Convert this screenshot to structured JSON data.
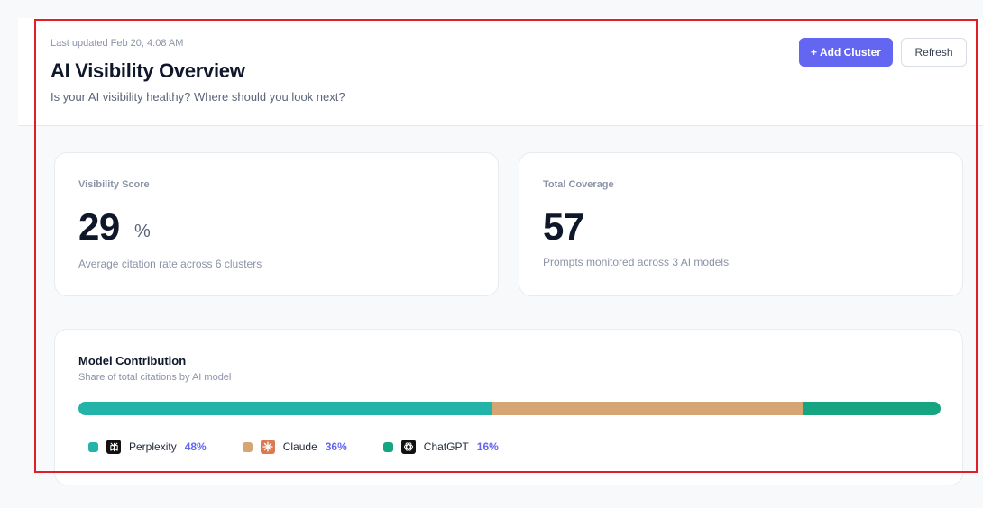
{
  "header": {
    "last_updated": "Last updated Feb 20, 4:08 AM",
    "title": "AI Visibility Overview",
    "subtitle": "Is your AI visibility healthy? Where should you look next?",
    "add_cluster_label": "+ Add Cluster",
    "refresh_label": "Refresh"
  },
  "stats": {
    "visibility": {
      "label": "Visibility Score",
      "value": "29",
      "unit": "%",
      "description": "Average citation rate across 6 clusters"
    },
    "coverage": {
      "label": "Total Coverage",
      "value": "57",
      "description": "Prompts monitored across 3 AI models"
    }
  },
  "models": {
    "title": "Model Contribution",
    "subtitle": "Share of total citations by AI model",
    "items": [
      {
        "name": "Perplexity",
        "percent_label": "48%",
        "share": 48,
        "color": "#22b3a9",
        "icon": "perplexity-icon",
        "icon_bg": "#111111"
      },
      {
        "name": "Claude",
        "percent_label": "36%",
        "share": 36,
        "color": "#d6a574",
        "icon": "claude-icon",
        "icon_bg": "#d97a52"
      },
      {
        "name": "ChatGPT",
        "percent_label": "16%",
        "share": 16,
        "color": "#17a480",
        "icon": "chatgpt-icon",
        "icon_bg": "#111111"
      }
    ]
  },
  "colors": {
    "accent": "#6366f1",
    "highlight": "#e11d2a"
  }
}
